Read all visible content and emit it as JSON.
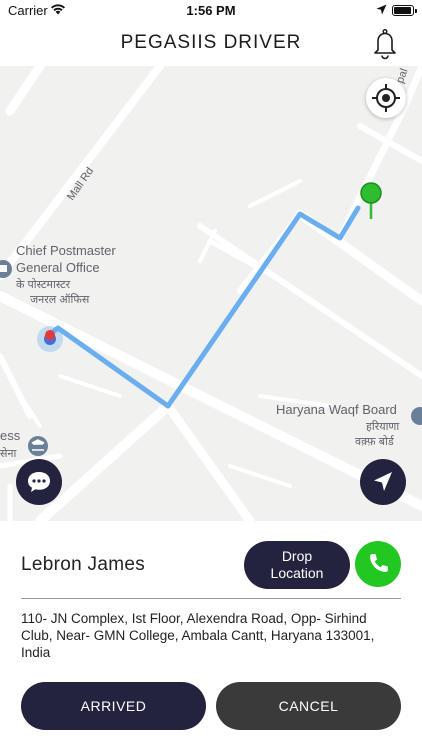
{
  "status_bar": {
    "carrier": "Carrier",
    "time": "1:56 PM"
  },
  "header": {
    "title": "PEGASIIS DRIVER",
    "notification_icon": "bell-icon"
  },
  "map": {
    "labels": {
      "mall_road": "Mall Rd",
      "chief_postmaster_en_line1": "Chief Postmaster",
      "chief_postmaster_en_line2": "General Office",
      "chief_postmaster_hi_line1": "के पोस्टमास्टर",
      "chief_postmaster_hi_line2": "जनरल ऑफिस",
      "haryana_waqf_en": "Haryana Waqf Board",
      "haryana_waqf_hi_line1": "हरियाणा",
      "haryana_waqf_hi_line2": "वक़्फ़ बोर्ड",
      "ess_partial": "ess",
      "sena_partial": "सेना",
      "pal_road_partial": "pal"
    },
    "route_color": "#6aaef0",
    "pickup_pin_color": "#2ebd2e",
    "current_location_color": "#e33b3b"
  },
  "controls": {
    "locate_icon": "crosshair-icon",
    "chat_icon": "chat-icon",
    "navigate_icon": "navigation-arrow-icon"
  },
  "trip": {
    "rider_name": "Lebron James",
    "drop_button_line1": "Drop",
    "drop_button_line2": "Location",
    "call_icon": "phone-icon",
    "address": "110- JN Complex, Ist Floor, Alexendra Road, Opp- Sirhind Club, Near- GMN College, Ambala Cantt, Haryana 133001, India",
    "arrived_label": "ARRIVED",
    "cancel_label": "CANCEL"
  },
  "colors": {
    "primary_dark": "#23233f",
    "call_green": "#22c722",
    "cancel_gray": "#3a3a3a"
  }
}
